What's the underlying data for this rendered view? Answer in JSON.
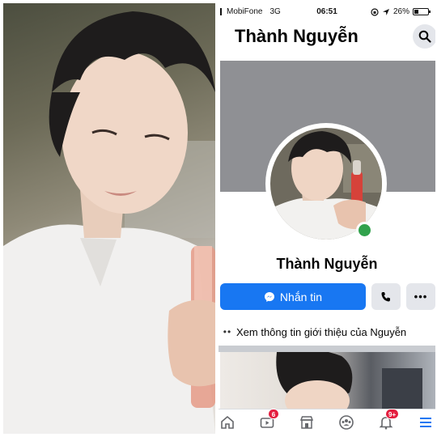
{
  "status_bar": {
    "carrier": "MobiFone",
    "network": "3G",
    "time": "06:51",
    "battery": "26%"
  },
  "header": {
    "title": "Thành Nguyễn",
    "search_icon": "search-icon"
  },
  "profile": {
    "name": "Thành Nguyễn",
    "online": true,
    "online_color": "#31a24c"
  },
  "actions": {
    "message_label": "Nhắn tin",
    "message_icon": "messenger-icon",
    "call_icon": "phone-icon",
    "more_label": "•••"
  },
  "about": {
    "dots": "••",
    "text": "Xem thông tin giới thiệu của Nguyễn"
  },
  "bottom_nav": {
    "items": [
      {
        "icon": "home-icon",
        "badge": ""
      },
      {
        "icon": "watch-icon",
        "badge": "6"
      },
      {
        "icon": "marketplace-icon",
        "badge": ""
      },
      {
        "icon": "groups-icon",
        "badge": ""
      },
      {
        "icon": "bell-icon",
        "badge": "9+"
      },
      {
        "icon": "menu-icon",
        "badge": ""
      }
    ]
  },
  "colors": {
    "accent": "#1877f2",
    "badge": "#e41e3f",
    "cover": "#8f9094"
  }
}
